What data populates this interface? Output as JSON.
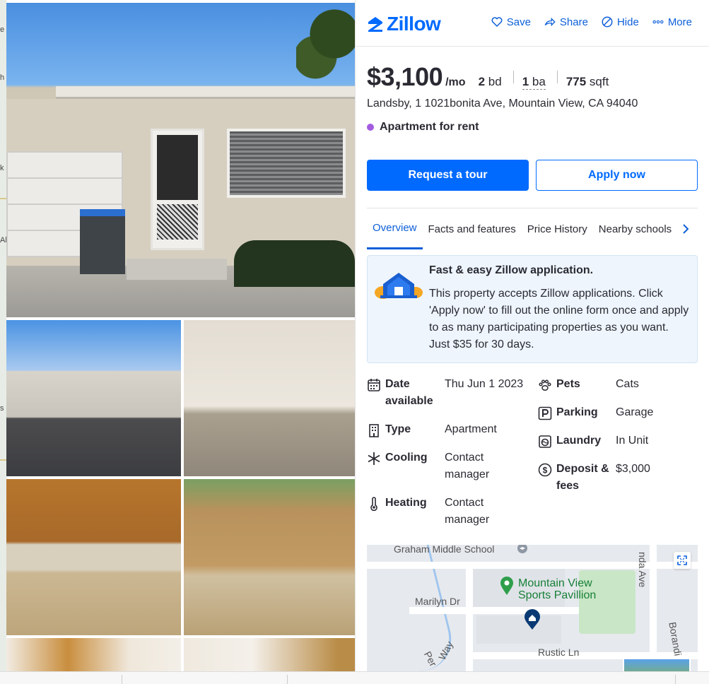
{
  "brand": {
    "name": "Zillow",
    "color": "#006aff"
  },
  "header_actions": [
    {
      "label": "Save",
      "icon": "heart-icon"
    },
    {
      "label": "Share",
      "icon": "share-icon"
    },
    {
      "label": "Hide",
      "icon": "hide-icon"
    },
    {
      "label": "More",
      "icon": "more-icon"
    }
  ],
  "listing": {
    "price": "$3,100",
    "price_unit": "/mo",
    "beds_num": "2",
    "beds_unit": "bd",
    "baths_num": "1",
    "baths_unit": "ba",
    "sqft_num": "775",
    "sqft_unit": "sqft",
    "address": "Landsby, 1 1021bonita Ave, Mountain View, CA 94040",
    "status": "Apartment for rent",
    "status_color": "#a35be0"
  },
  "cta": {
    "tour": "Request a tour",
    "apply": "Apply now"
  },
  "tabs": [
    "Overview",
    "Facts and features",
    "Price History",
    "Nearby schools"
  ],
  "apply_card": {
    "heading": "Fast & easy Zillow application.",
    "text": "This property accepts Zillow applications. Click 'Apply now' to fill out the online form once and apply to as many participating properties as you want. Just $35 for 30 days."
  },
  "facts_left": [
    {
      "key": "Date available",
      "value": "Thu Jun 1 2023",
      "icon": "calendar-icon"
    },
    {
      "key": "Type",
      "value": "Apartment",
      "icon": "building-icon"
    },
    {
      "key": "Cooling",
      "value": "Contact manager",
      "icon": "snowflake-icon"
    },
    {
      "key": "Heating",
      "value": "Contact manager",
      "icon": "thermometer-icon"
    }
  ],
  "facts_right": [
    {
      "key": "Pets",
      "value": "Cats",
      "icon": "paw-icon"
    },
    {
      "key": "Parking",
      "value": "Garage",
      "icon": "parking-icon"
    },
    {
      "key": "Laundry",
      "value": "In Unit",
      "icon": "washer-icon"
    },
    {
      "key": "Deposit & fees",
      "value": "$3,000",
      "icon": "dollar-icon"
    }
  ],
  "map": {
    "labels": {
      "school": "Graham Middle School",
      "park_1": "Mountain View",
      "park_2": "Sports Pavillion",
      "marilyn": "Marilyn Dr",
      "rustic": "Rustic Ln",
      "ave": "nda Ave",
      "borand": "Borandi",
      "way": "Way",
      "per": "Per"
    }
  },
  "map_strip_labels": [
    "e",
    "h",
    "k",
    "Al",
    "s"
  ]
}
